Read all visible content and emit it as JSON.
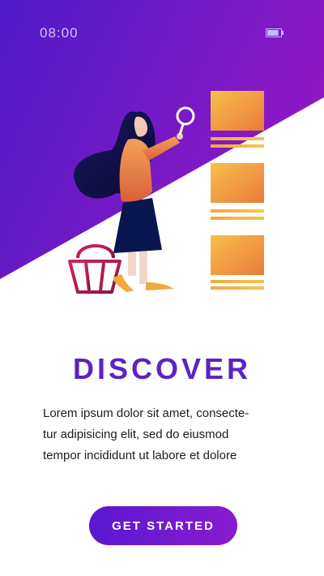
{
  "status_bar": {
    "time": "08:00",
    "battery_icon": "battery-icon",
    "battery_level": 0.8
  },
  "illustration": {
    "subject": "woman-with-magnifier-illustration",
    "icons": [
      "magnifier-icon",
      "shopping-basket-icon",
      "product-card-icon"
    ],
    "colors": {
      "hero_gradient_start": "#4e1bc7",
      "hero_gradient_end": "#9018c4",
      "card_gradient_start": "#f7c04a",
      "card_gradient_end": "#ea7a3c",
      "basket": "#c2185b"
    }
  },
  "onboarding": {
    "title": "DISCOVER",
    "body_lines": [
      "Lorem ipsum dolor sit amet, consecte-",
      "tur adipisicing elit, sed do eiusmod",
      "tempor incididunt ut labore et dolore"
    ],
    "cta_label": "GET STARTED"
  },
  "colors": {
    "accent": "#5b24c4",
    "button_gradient_start": "#5a18cf",
    "button_gradient_end": "#8a1ccf",
    "text": "#1c1c1c"
  }
}
